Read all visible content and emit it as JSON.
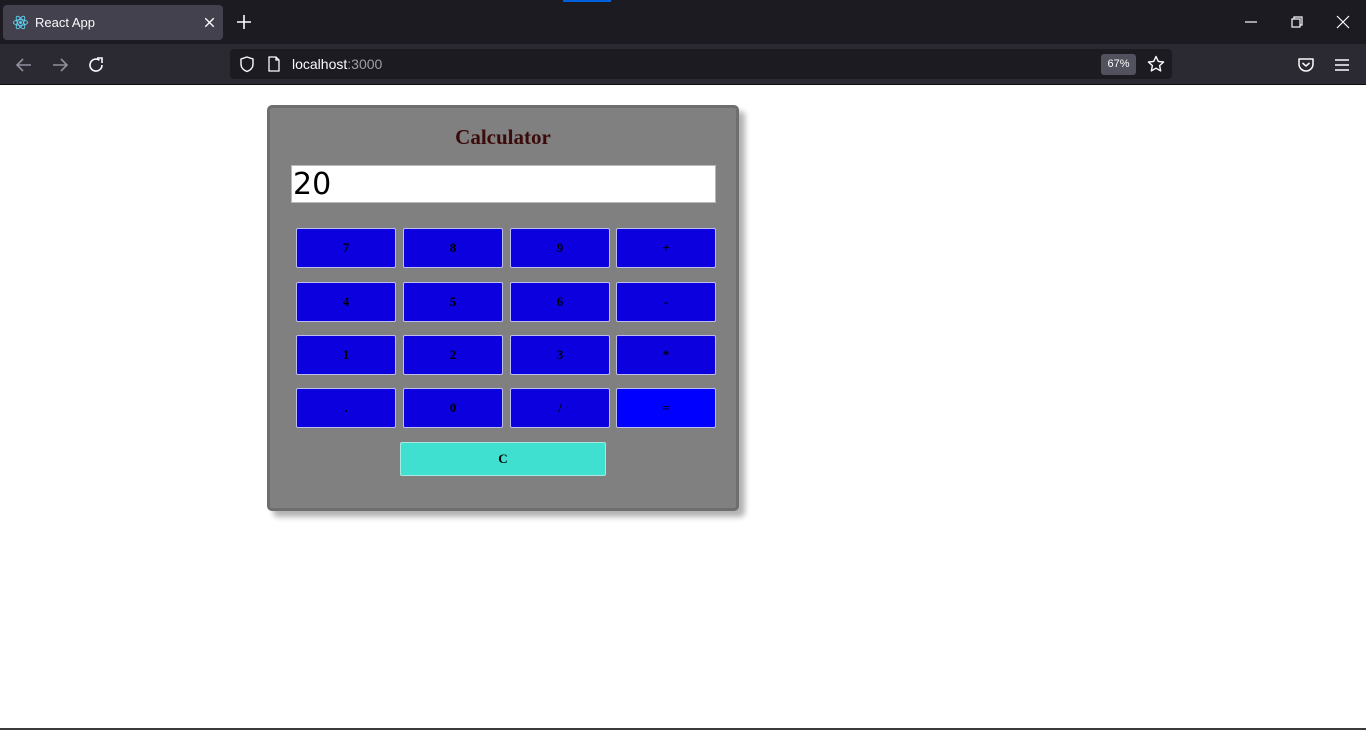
{
  "browser": {
    "tab": {
      "title": "React App",
      "favicon": "react-logo-icon"
    },
    "url": {
      "host": "localhost",
      "port": ":3000"
    },
    "zoom": "67%",
    "icons": {
      "back": "arrow-left-icon",
      "forward": "arrow-right-icon",
      "reload": "reload-icon",
      "shield": "tracking-shield-icon",
      "bookmark": "star-icon",
      "pocket": "pocket-icon",
      "menu": "hamburger-menu-icon"
    }
  },
  "calculator": {
    "title": "Calculator",
    "display_value": "20",
    "keys": [
      "7",
      "8",
      "9",
      "+",
      "4",
      "5",
      "6",
      "-",
      "1",
      "2",
      "3",
      "*",
      ".",
      "0",
      "/",
      "="
    ],
    "clear_label": "C",
    "colors": {
      "panel": "#808080",
      "key": "#0c00de",
      "equals": "#0000ff",
      "clear": "#40e0d0",
      "title": "#3b0a0a"
    }
  }
}
